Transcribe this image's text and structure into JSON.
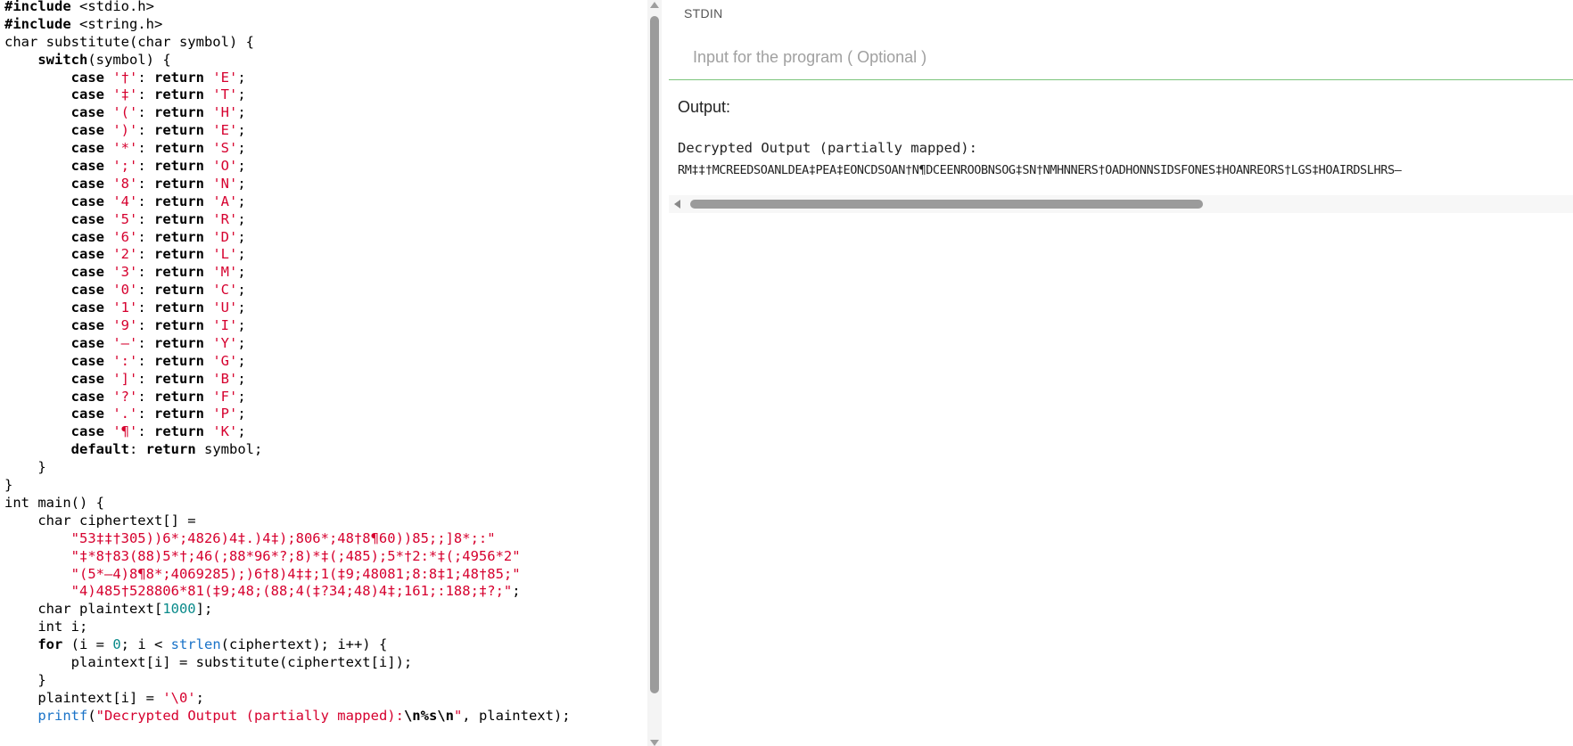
{
  "editor": {
    "code_lines": [
      [
        {
          "t": "#include",
          "c": "kw"
        },
        {
          "t": " <stdio.h>"
        }
      ],
      [
        {
          "t": "#include",
          "c": "kw"
        },
        {
          "t": " <string.h>"
        }
      ],
      [
        {
          "t": "char substitute(char symbol) {"
        }
      ],
      [
        {
          "t": "    "
        },
        {
          "t": "switch",
          "c": "kw"
        },
        {
          "t": "(symbol) {"
        }
      ],
      [
        {
          "t": "        "
        },
        {
          "t": "case",
          "c": "kw"
        },
        {
          "t": " "
        },
        {
          "t": "'†'",
          "c": "str"
        },
        {
          "t": ": "
        },
        {
          "t": "return",
          "c": "kw"
        },
        {
          "t": " "
        },
        {
          "t": "'E'",
          "c": "str"
        },
        {
          "t": ";"
        }
      ],
      [
        {
          "t": "        "
        },
        {
          "t": "case",
          "c": "kw"
        },
        {
          "t": " "
        },
        {
          "t": "'‡'",
          "c": "str"
        },
        {
          "t": ": "
        },
        {
          "t": "return",
          "c": "kw"
        },
        {
          "t": " "
        },
        {
          "t": "'T'",
          "c": "str"
        },
        {
          "t": ";"
        }
      ],
      [
        {
          "t": "        "
        },
        {
          "t": "case",
          "c": "kw"
        },
        {
          "t": " "
        },
        {
          "t": "'('",
          "c": "str"
        },
        {
          "t": ": "
        },
        {
          "t": "return",
          "c": "kw"
        },
        {
          "t": " "
        },
        {
          "t": "'H'",
          "c": "str"
        },
        {
          "t": ";"
        }
      ],
      [
        {
          "t": "        "
        },
        {
          "t": "case",
          "c": "kw"
        },
        {
          "t": " "
        },
        {
          "t": "')'",
          "c": "str"
        },
        {
          "t": ": "
        },
        {
          "t": "return",
          "c": "kw"
        },
        {
          "t": " "
        },
        {
          "t": "'E'",
          "c": "str"
        },
        {
          "t": ";"
        }
      ],
      [
        {
          "t": "        "
        },
        {
          "t": "case",
          "c": "kw"
        },
        {
          "t": " "
        },
        {
          "t": "'*'",
          "c": "str"
        },
        {
          "t": ": "
        },
        {
          "t": "return",
          "c": "kw"
        },
        {
          "t": " "
        },
        {
          "t": "'S'",
          "c": "str"
        },
        {
          "t": ";"
        }
      ],
      [
        {
          "t": "        "
        },
        {
          "t": "case",
          "c": "kw"
        },
        {
          "t": " "
        },
        {
          "t": "';'",
          "c": "str"
        },
        {
          "t": ": "
        },
        {
          "t": "return",
          "c": "kw"
        },
        {
          "t": " "
        },
        {
          "t": "'O'",
          "c": "str"
        },
        {
          "t": ";"
        }
      ],
      [
        {
          "t": "        "
        },
        {
          "t": "case",
          "c": "kw"
        },
        {
          "t": " "
        },
        {
          "t": "'8'",
          "c": "str"
        },
        {
          "t": ": "
        },
        {
          "t": "return",
          "c": "kw"
        },
        {
          "t": " "
        },
        {
          "t": "'N'",
          "c": "str"
        },
        {
          "t": ";"
        }
      ],
      [
        {
          "t": "        "
        },
        {
          "t": "case",
          "c": "kw"
        },
        {
          "t": " "
        },
        {
          "t": "'4'",
          "c": "str"
        },
        {
          "t": ": "
        },
        {
          "t": "return",
          "c": "kw"
        },
        {
          "t": " "
        },
        {
          "t": "'A'",
          "c": "str"
        },
        {
          "t": ";"
        }
      ],
      [
        {
          "t": "        "
        },
        {
          "t": "case",
          "c": "kw"
        },
        {
          "t": " "
        },
        {
          "t": "'5'",
          "c": "str"
        },
        {
          "t": ": "
        },
        {
          "t": "return",
          "c": "kw"
        },
        {
          "t": " "
        },
        {
          "t": "'R'",
          "c": "str"
        },
        {
          "t": ";"
        }
      ],
      [
        {
          "t": "        "
        },
        {
          "t": "case",
          "c": "kw"
        },
        {
          "t": " "
        },
        {
          "t": "'6'",
          "c": "str"
        },
        {
          "t": ": "
        },
        {
          "t": "return",
          "c": "kw"
        },
        {
          "t": " "
        },
        {
          "t": "'D'",
          "c": "str"
        },
        {
          "t": ";"
        }
      ],
      [
        {
          "t": "        "
        },
        {
          "t": "case",
          "c": "kw"
        },
        {
          "t": " "
        },
        {
          "t": "'2'",
          "c": "str"
        },
        {
          "t": ": "
        },
        {
          "t": "return",
          "c": "kw"
        },
        {
          "t": " "
        },
        {
          "t": "'L'",
          "c": "str"
        },
        {
          "t": ";"
        }
      ],
      [
        {
          "t": "        "
        },
        {
          "t": "case",
          "c": "kw"
        },
        {
          "t": " "
        },
        {
          "t": "'3'",
          "c": "str"
        },
        {
          "t": ": "
        },
        {
          "t": "return",
          "c": "kw"
        },
        {
          "t": " "
        },
        {
          "t": "'M'",
          "c": "str"
        },
        {
          "t": ";"
        }
      ],
      [
        {
          "t": "        "
        },
        {
          "t": "case",
          "c": "kw"
        },
        {
          "t": " "
        },
        {
          "t": "'0'",
          "c": "str"
        },
        {
          "t": ": "
        },
        {
          "t": "return",
          "c": "kw"
        },
        {
          "t": " "
        },
        {
          "t": "'C'",
          "c": "str"
        },
        {
          "t": ";"
        }
      ],
      [
        {
          "t": "        "
        },
        {
          "t": "case",
          "c": "kw"
        },
        {
          "t": " "
        },
        {
          "t": "'1'",
          "c": "str"
        },
        {
          "t": ": "
        },
        {
          "t": "return",
          "c": "kw"
        },
        {
          "t": " "
        },
        {
          "t": "'U'",
          "c": "str"
        },
        {
          "t": ";"
        }
      ],
      [
        {
          "t": "        "
        },
        {
          "t": "case",
          "c": "kw"
        },
        {
          "t": " "
        },
        {
          "t": "'9'",
          "c": "str"
        },
        {
          "t": ": "
        },
        {
          "t": "return",
          "c": "kw"
        },
        {
          "t": " "
        },
        {
          "t": "'I'",
          "c": "str"
        },
        {
          "t": ";"
        }
      ],
      [
        {
          "t": "        "
        },
        {
          "t": "case",
          "c": "kw"
        },
        {
          "t": " "
        },
        {
          "t": "'—'",
          "c": "str"
        },
        {
          "t": ": "
        },
        {
          "t": "return",
          "c": "kw"
        },
        {
          "t": " "
        },
        {
          "t": "'Y'",
          "c": "str"
        },
        {
          "t": ";"
        }
      ],
      [
        {
          "t": "        "
        },
        {
          "t": "case",
          "c": "kw"
        },
        {
          "t": " "
        },
        {
          "t": "':'",
          "c": "str"
        },
        {
          "t": ": "
        },
        {
          "t": "return",
          "c": "kw"
        },
        {
          "t": " "
        },
        {
          "t": "'G'",
          "c": "str"
        },
        {
          "t": ";"
        }
      ],
      [
        {
          "t": "        "
        },
        {
          "t": "case",
          "c": "kw"
        },
        {
          "t": " "
        },
        {
          "t": "']'",
          "c": "str"
        },
        {
          "t": ": "
        },
        {
          "t": "return",
          "c": "kw"
        },
        {
          "t": " "
        },
        {
          "t": "'B'",
          "c": "str"
        },
        {
          "t": ";"
        }
      ],
      [
        {
          "t": "        "
        },
        {
          "t": "case",
          "c": "kw"
        },
        {
          "t": " "
        },
        {
          "t": "'?'",
          "c": "str"
        },
        {
          "t": ": "
        },
        {
          "t": "return",
          "c": "kw"
        },
        {
          "t": " "
        },
        {
          "t": "'F'",
          "c": "str"
        },
        {
          "t": ";"
        }
      ],
      [
        {
          "t": "        "
        },
        {
          "t": "case",
          "c": "kw"
        },
        {
          "t": " "
        },
        {
          "t": "'.'",
          "c": "str"
        },
        {
          "t": ": "
        },
        {
          "t": "return",
          "c": "kw"
        },
        {
          "t": " "
        },
        {
          "t": "'P'",
          "c": "str"
        },
        {
          "t": ";"
        }
      ],
      [
        {
          "t": "        "
        },
        {
          "t": "case",
          "c": "kw"
        },
        {
          "t": " "
        },
        {
          "t": "'¶'",
          "c": "str"
        },
        {
          "t": ": "
        },
        {
          "t": "return",
          "c": "kw"
        },
        {
          "t": " "
        },
        {
          "t": "'K'",
          "c": "str"
        },
        {
          "t": ";"
        }
      ],
      [
        {
          "t": "        "
        },
        {
          "t": "default",
          "c": "kw"
        },
        {
          "t": ": "
        },
        {
          "t": "return",
          "c": "kw"
        },
        {
          "t": " symbol;"
        }
      ],
      [
        {
          "t": "    }"
        }
      ],
      [
        {
          "t": "}"
        }
      ],
      [
        {
          "t": "int main() {"
        }
      ],
      [
        {
          "t": "    char ciphertext[] ="
        }
      ],
      [
        {
          "t": "        "
        },
        {
          "t": "\"53‡‡†305))6*;4826)4‡.)4‡);806*;48†8¶60))85;;]8*;:\"",
          "c": "str"
        }
      ],
      [
        {
          "t": "        "
        },
        {
          "t": "\"‡*8†83(88)5*†;46(;88*96*?;8)*‡(;485);5*†2:*‡(;4956*2\"",
          "c": "str"
        }
      ],
      [
        {
          "t": "        "
        },
        {
          "t": "\"(5*—4)8¶8*;4069285);)6†8)4‡‡;1(‡9;48081;8:8‡1;48†85;\"",
          "c": "str"
        }
      ],
      [
        {
          "t": "        "
        },
        {
          "t": "\"4)485†528806*81(‡9;48;(88;4(‡?34;48)4‡;161;:188;‡?;\"",
          "c": "str"
        },
        {
          "t": ";"
        }
      ],
      [
        {
          "t": "    char plaintext["
        },
        {
          "t": "1000",
          "c": "num"
        },
        {
          "t": "];"
        }
      ],
      [
        {
          "t": "    int i;"
        }
      ],
      [
        {
          "t": "    "
        },
        {
          "t": "for",
          "c": "kw"
        },
        {
          "t": " (i = "
        },
        {
          "t": "0",
          "c": "num"
        },
        {
          "t": "; i < "
        },
        {
          "t": "strlen",
          "c": "fn"
        },
        {
          "t": "(ciphertext); i++) {"
        }
      ],
      [
        {
          "t": "        plaintext[i] = substitute(ciphertext[i]);"
        }
      ],
      [
        {
          "t": "    }"
        }
      ],
      [
        {
          "t": "    plaintext[i] = "
        },
        {
          "t": "'\\0'",
          "c": "str"
        },
        {
          "t": ";"
        }
      ],
      [
        {
          "t": "    "
        },
        {
          "t": "printf",
          "c": "fn"
        },
        {
          "t": "("
        },
        {
          "t": "\"Decrypted Output (partially mapped):",
          "c": "str"
        },
        {
          "t": "\\n%s\\n",
          "c": "esc"
        },
        {
          "t": "\"",
          "c": "str"
        },
        {
          "t": ", plaintext);"
        }
      ]
    ]
  },
  "stdin": {
    "label": "STDIN",
    "placeholder": "Input for the program ( Optional )",
    "value": ""
  },
  "output": {
    "label": "Output:",
    "lines": [
      "Decrypted Output (partially mapped):",
      "RM‡‡†MCREEDSOANLDEA‡PEA‡EONCDSOAN†N¶DCEENROOBNSOG‡SN†NMHNNERS†OADHONNSIDSFONES‡HOANREORS†LGS‡HOAIRDSLHRS—"
    ]
  },
  "colors": {
    "string": "#d6002e",
    "number": "#098a8a",
    "function": "#1a73c8",
    "input_border": "#7cc47c",
    "scrollbar_thumb": "#9b9b9b"
  }
}
